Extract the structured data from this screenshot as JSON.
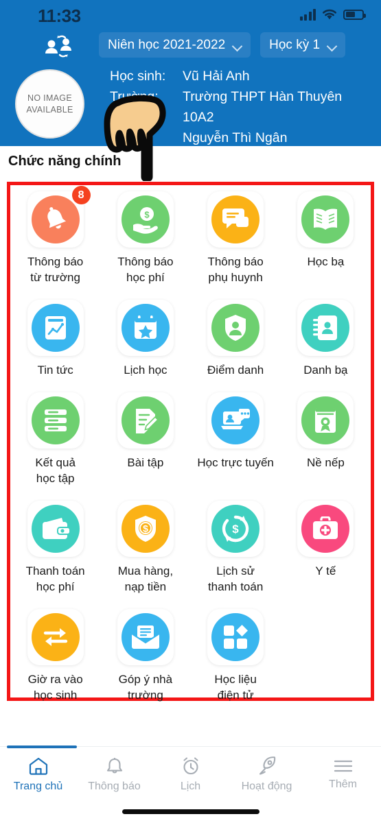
{
  "status_bar": {
    "time": "11:33",
    "signal_icon": "signal-bars-icon",
    "wifi_icon": "wifi-icon",
    "battery_icon": "battery-icon"
  },
  "header": {
    "switch_student_icon": "switch-students-icon",
    "school_year": {
      "label": "Niên học 2021-2022",
      "chevron": "chevron-down-icon"
    },
    "semester": {
      "label": "Học kỳ 1",
      "chevron": "chevron-down-icon"
    },
    "avatar": {
      "line1": "NO IMAGE",
      "line2": "AVAILABLE"
    },
    "student_key": "Học sinh:",
    "student_name": "Vũ Hải Anh",
    "school_key": "Trường:",
    "school_name": "Trường THPT  Hàn Thuyên",
    "class_name": "10A2",
    "teacher_name": "Nguyễn Thì Ngân",
    "background_color": "#1173be"
  },
  "section": {
    "title": "Chức năng chính"
  },
  "annotation": {
    "box_color": "#f41616"
  },
  "grid": {
    "items": [
      {
        "label_line1": "Thông báo",
        "label_line2": "từ trường",
        "icon": "bell-icon",
        "color": "#f9805c",
        "badge": "8"
      },
      {
        "label_line1": "Thông báo",
        "label_line2": "học phí",
        "icon": "hand-money-icon",
        "color": "#6ed070",
        "badge": ""
      },
      {
        "label_line1": "Thông báo",
        "label_line2": "phụ huynh",
        "icon": "chat-bubble-icon",
        "color": "#fbb216",
        "badge": ""
      },
      {
        "label_line1": "Học bạ",
        "label_line2": "",
        "icon": "open-book-icon",
        "color": "#6ed070",
        "badge": ""
      },
      {
        "label_line1": "Tin tức",
        "label_line2": "",
        "icon": "news-chart-icon",
        "color": "#39b6ef",
        "badge": ""
      },
      {
        "label_line1": "Lịch học",
        "label_line2": "",
        "icon": "calendar-star-icon",
        "color": "#39b6ef",
        "badge": ""
      },
      {
        "label_line1": "Điểm danh",
        "label_line2": "",
        "icon": "shield-person-icon",
        "color": "#6ed070",
        "badge": ""
      },
      {
        "label_line1": "Danh bạ",
        "label_line2": "",
        "icon": "contact-book-icon",
        "color": "#3fd0c0",
        "badge": ""
      },
      {
        "label_line1": "Kết quả",
        "label_line2": "học tập",
        "icon": "results-list-icon",
        "color": "#6ed070",
        "badge": ""
      },
      {
        "label_line1": "Bài tập",
        "label_line2": "",
        "icon": "homework-pencil-icon",
        "color": "#6ed070",
        "badge": ""
      },
      {
        "label_line1": "Học trực tuyến",
        "label_line2": "",
        "icon": "laptop-chat-icon",
        "color": "#39b6ef",
        "badge": ""
      },
      {
        "label_line1": "Nề nếp",
        "label_line2": "",
        "icon": "certificate-icon",
        "color": "#6ed070",
        "badge": ""
      },
      {
        "label_line1": "Thanh toán",
        "label_line2": "học phí",
        "icon": "wallet-icon",
        "color": "#3fd0c0",
        "badge": ""
      },
      {
        "label_line1": "Mua hàng,",
        "label_line2": "nạp tiền",
        "icon": "shield-dollar-icon",
        "color": "#fbb216",
        "badge": ""
      },
      {
        "label_line1": "Lịch sử",
        "label_line2": "thanh toán",
        "icon": "payment-history-icon",
        "color": "#3fd0c0",
        "badge": ""
      },
      {
        "label_line1": "Y tế",
        "label_line2": "",
        "icon": "medical-kit-icon",
        "color": "#f9497e",
        "badge": ""
      },
      {
        "label_line1": "Giờ ra vào",
        "label_line2": "học sinh",
        "icon": "transfer-arrows-icon",
        "color": "#fbb216",
        "badge": ""
      },
      {
        "label_line1": "Góp ý nhà",
        "label_line2": "trường",
        "icon": "envelope-icon",
        "color": "#39b6ef",
        "badge": ""
      },
      {
        "label_line1": "Học liệu",
        "label_line2": "điện tử",
        "icon": "grid-blocks-icon",
        "color": "#39b6ef",
        "badge": ""
      }
    ]
  },
  "tabbar": {
    "active_color": "#1e72b8",
    "items": [
      {
        "label": "Trang chủ",
        "icon": "home-icon",
        "active": true
      },
      {
        "label": "Thông báo",
        "icon": "bell-outline-icon",
        "active": false
      },
      {
        "label": "Lịch",
        "icon": "alarm-clock-icon",
        "active": false
      },
      {
        "label": "Hoạt động",
        "icon": "rocket-icon",
        "active": false
      },
      {
        "label": "Thêm",
        "icon": "hamburger-menu-icon",
        "active": false
      }
    ]
  }
}
